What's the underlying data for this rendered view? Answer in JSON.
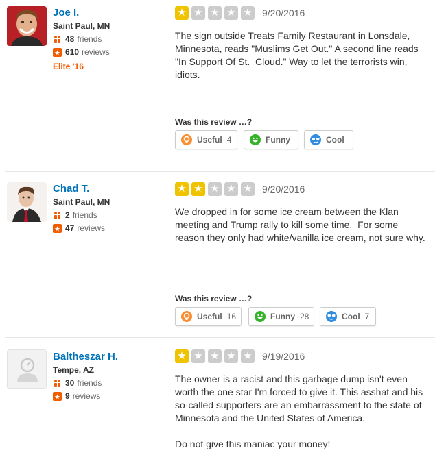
{
  "review_meta": {
    "was_label": "Was this review …?"
  },
  "votes_labels": {
    "useful": "Useful",
    "funny": "Funny",
    "cool": "Cool"
  },
  "colors": {
    "star_filled": "#f0c300",
    "star_empty": "#cccccc",
    "link": "#0073bb",
    "elite": "#f15c00",
    "useful_icon": "#f98e32",
    "funny_icon": "#36b22a",
    "cool_icon": "#2f8ce0"
  },
  "reviews": [
    {
      "user": {
        "name": "Joe I.",
        "location": "Saint Paul, MN",
        "friends": "48",
        "friends_label": "friends",
        "reviews": "610",
        "reviews_label": "reviews",
        "elite": "Elite '16",
        "avatar": "photo-avatar"
      },
      "rating": 1,
      "date": "9/20/2016",
      "text": "The sign outside Treats Family Restaurant in Lonsdale, Minnesota, reads \"Muslims Get Out.\" A second line reads \"In Support Of St.  Cloud.\" Way to let the terrorists win, idiots.",
      "votes": {
        "useful": "4",
        "funny": "",
        "cool": ""
      }
    },
    {
      "user": {
        "name": "Chad T.",
        "location": "Saint Paul, MN",
        "friends": "2",
        "friends_label": "friends",
        "reviews": "47",
        "reviews_label": "reviews",
        "avatar": "photo-avatar"
      },
      "rating": 2,
      "date": "9/20/2016",
      "text": "We dropped in for some ice cream between the Klan meeting and Trump rally to kill some time.  For some reason they only had white/vanilla ice cream, not sure why.",
      "votes": {
        "useful": "16",
        "funny": "28",
        "cool": "7"
      }
    },
    {
      "user": {
        "name": "Baltheszar H.",
        "location": "Tempe, AZ",
        "friends": "30",
        "friends_label": "friends",
        "reviews": "9",
        "reviews_label": "reviews",
        "avatar": "default-avatar"
      },
      "rating": 1,
      "date": "9/19/2016",
      "text": "The owner is a racist and this garbage dump isn't even worth the one star I'm forced to give it. This asshat and his so-called supporters are an embarrassment to the state of Minnesota and the United States of America.\n\nDo not give this maniac your money!",
      "votes": {
        "useful": "",
        "funny": "",
        "cool": ""
      }
    }
  ]
}
